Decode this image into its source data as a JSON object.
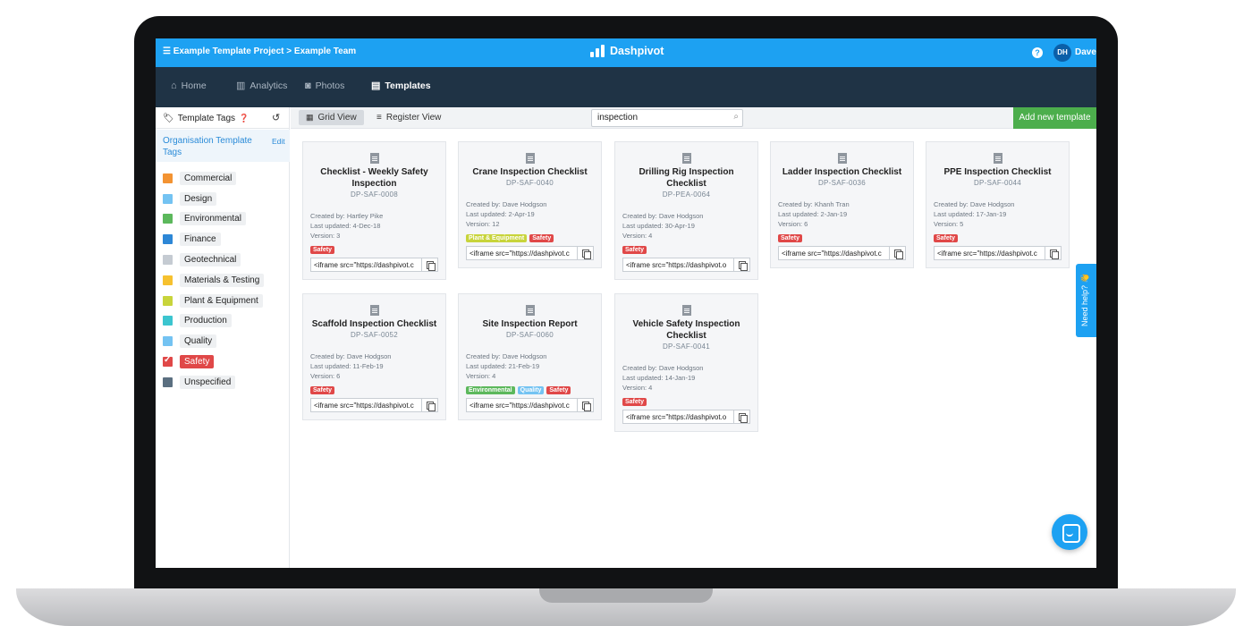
{
  "topbar": {
    "breadcrumb": "Example Template Project > Example Team",
    "brand": "Dashpivot",
    "help": "?",
    "avatar_initials": "DH",
    "username": "Dave"
  },
  "nav": {
    "items": [
      {
        "label": "Home",
        "icon": "home-icon"
      },
      {
        "label": "Analytics",
        "icon": "bar-chart-icon"
      },
      {
        "label": "Photos",
        "icon": "camera-icon"
      },
      {
        "label": "Templates",
        "icon": "document-icon",
        "active": true
      }
    ]
  },
  "sidebar": {
    "title": "Template Tags",
    "org_label": "Organisation Template Tags",
    "edit_label": "Edit",
    "tags": [
      {
        "name": "Commercial",
        "color": "#f39332"
      },
      {
        "name": "Design",
        "color": "#74c3f2"
      },
      {
        "name": "Environmental",
        "color": "#5cb85c"
      },
      {
        "name": "Finance",
        "color": "#2d87d6"
      },
      {
        "name": "Geotechnical",
        "color": "#c5cbd2"
      },
      {
        "name": "Materials & Testing",
        "color": "#f6c12f"
      },
      {
        "name": "Plant & Equipment",
        "color": "#c8d43b"
      },
      {
        "name": "Production",
        "color": "#3cc5cf"
      },
      {
        "name": "Quality",
        "color": "#74c3f2"
      },
      {
        "name": "Safety",
        "color": "#e04848",
        "selected": true
      },
      {
        "name": "Unspecified",
        "color": "#5b6f80"
      }
    ]
  },
  "toolbar": {
    "grid_view": "Grid View",
    "register_view": "Register View",
    "search_value": "inspection",
    "add_button": "Add new template"
  },
  "tag_colors": {
    "Safety": "#e04848",
    "Plant & Equipment": "#c8d43b",
    "Environmental": "#5cb85c",
    "Quality": "#74c3f2"
  },
  "templates": [
    {
      "title": "Checklist - Weekly Safety Inspection",
      "code": "DP-SAF-0008",
      "created": "Created by: Hartley Pike",
      "updated": "Last updated: 4-Dec-18",
      "version": "Version: 3",
      "tags": [
        "Safety"
      ],
      "embed": "<iframe src=\"https://dashpivot.c"
    },
    {
      "title": "Crane Inspection Checklist",
      "code": "DP-SAF-0040",
      "created": "Created by: Dave Hodgson",
      "updated": "Last updated: 2-Apr-19",
      "version": "Version: 12",
      "tags": [
        "Plant & Equipment",
        "Safety"
      ],
      "embed": "<iframe src=\"https://dashpivot.c"
    },
    {
      "title": "Drilling Rig Inspection Checklist",
      "code": "DP-PEA-0064",
      "created": "Created by: Dave Hodgson",
      "updated": "Last updated: 30-Apr-19",
      "version": "Version: 4",
      "tags": [
        "Safety"
      ],
      "embed": "<iframe src=\"https://dashpivot.o"
    },
    {
      "title": "Ladder Inspection Checklist",
      "code": "DP-SAF-0036",
      "created": "Created by: Khanh Tran",
      "updated": "Last updated: 2-Jan-19",
      "version": "Version: 6",
      "tags": [
        "Safety"
      ],
      "embed": "<iframe src=\"https://dashpivot.c"
    },
    {
      "title": "PPE Inspection Checklist",
      "code": "DP-SAF-0044",
      "created": "Created by: Dave Hodgson",
      "updated": "Last updated: 17-Jan-19",
      "version": "Version: 5",
      "tags": [
        "Safety"
      ],
      "embed": "<iframe src=\"https://dashpivot.c"
    },
    {
      "title": "Scaffold Inspection Checklist",
      "code": "DP-SAF-0052",
      "created": "Created by: Dave Hodgson",
      "updated": "Last updated: 11-Feb-19",
      "version": "Version: 6",
      "tags": [
        "Safety"
      ],
      "embed": "<iframe src=\"https://dashpivot.c"
    },
    {
      "title": "Site Inspection Report",
      "code": "DP-SAF-0060",
      "created": "Created by: Dave Hodgson",
      "updated": "Last updated: 21-Feb-19",
      "version": "Version: 4",
      "tags": [
        "Environmental",
        "Quality",
        "Safety"
      ],
      "embed": "<iframe src=\"https://dashpivot.c"
    },
    {
      "title": "Vehicle Safety Inspection Checklist",
      "code": "DP-SAF-0041",
      "created": "Created by: Dave Hodgson",
      "updated": "Last updated: 14-Jan-19",
      "version": "Version: 4",
      "tags": [
        "Safety"
      ],
      "embed": "<iframe src=\"https://dashpivot.o"
    }
  ],
  "widgets": {
    "need_help": "Need help? 👋"
  }
}
